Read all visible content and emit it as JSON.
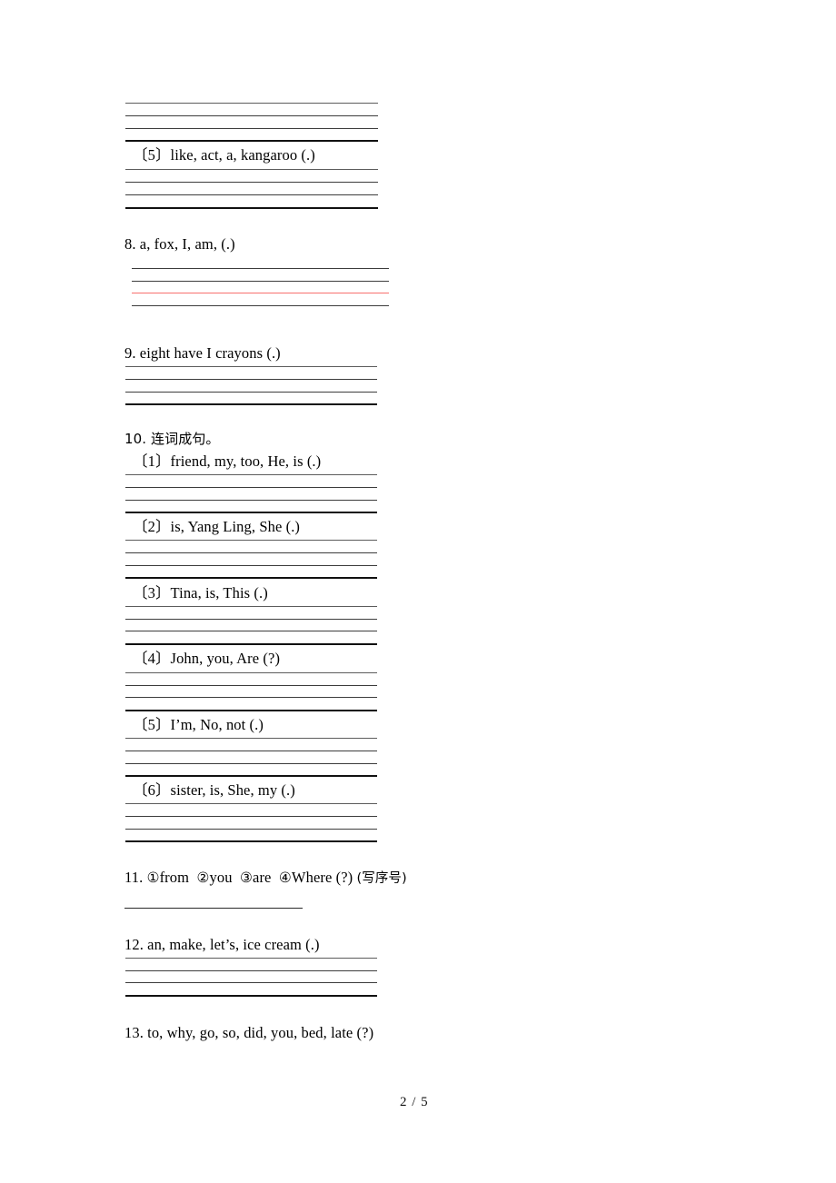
{
  "document": {
    "type": "worksheet",
    "subject": "English sentence-ordering exercises",
    "page_footer": "2 / 5"
  },
  "items": {
    "q5_sub": "〔5〕like, act, a, kangaroo (.)",
    "q8": "8. a, fox, I, am, (.)",
    "q9": "9. eight  have  I  crayons (.)",
    "q10_heading": "10. 连词成句。",
    "q10_1": "〔1〕friend, my, too, He, is (.)",
    "q10_2": "〔2〕is, Yang Ling, She (.)",
    "q10_3": "〔3〕Tina, is, This (.)",
    "q10_4": "〔4〕John, you, Are (?)",
    "q10_5": "〔5〕I’m, No, not (.)",
    "q10_6": "〔6〕sister, is, She, my (.)",
    "q11_num": "11.",
    "q11_c1": "①",
    "q11_w1": "from",
    "q11_c2": "②",
    "q11_w2": "you",
    "q11_c3": "③",
    "q11_w3": "are",
    "q11_c4": "④",
    "q11_w4": "Where (?)",
    "q11_note": "(写序号)",
    "q12": "12. an, make, let’s, ice cream (.)",
    "q13": "13. to, why, go, so, did, you, bed, late (?)"
  },
  "colors": {
    "red_rule": "#f8706e",
    "dark_rule": "#111111",
    "gray_rule": "#4a4a4a",
    "text": "#000000"
  }
}
